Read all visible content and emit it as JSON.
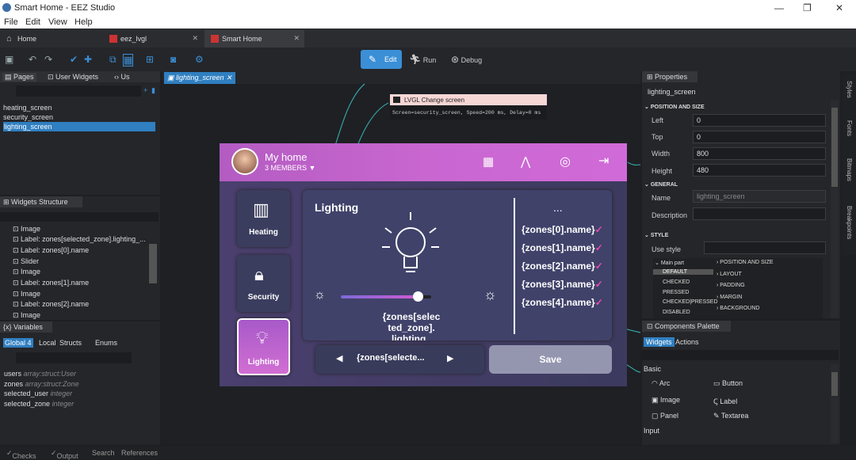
{
  "window": {
    "title": "Smart Home - EEZ Studio",
    "minimize": "—",
    "maximize": "❐",
    "close": "✕"
  },
  "menu": [
    "File",
    "Edit",
    "View",
    "Help"
  ],
  "tabs": [
    {
      "label": "Home"
    },
    {
      "label": "eez_lvgl"
    },
    {
      "label": "Smart Home"
    }
  ],
  "toolbar": {
    "edit": "Edit",
    "run": "Run",
    "debug": "Debug"
  },
  "left": {
    "tabs": [
      "Pages",
      "User Widgets",
      "Us"
    ],
    "pages": [
      "heating_screen",
      "security_screen",
      "lighting_screen"
    ],
    "widgets_title": "Widgets Structure",
    "widgets": [
      "Image",
      "Label: zones[selected_zone].lighting_...",
      "Label: zones[0].name",
      "Slider",
      "Image",
      "Label: zones[1].name",
      "Image",
      "Label: zones[2].name",
      "Image"
    ],
    "variables_title": "Variables",
    "var_tabs": [
      "Global",
      "Local",
      "Structs",
      "Enums"
    ],
    "global_count": "4",
    "vars": [
      {
        "name": "users",
        "type": "array:struct:User"
      },
      {
        "name": "zones",
        "type": "array:struct:Zone"
      },
      {
        "name": "selected_user",
        "type": "integer"
      },
      {
        "name": "selected_zone",
        "type": "integer"
      }
    ]
  },
  "editor_tab": "lighting_screen",
  "flow": {
    "node_title": "LVGL Change screen",
    "node_desc": "Screen=security_screen, Speed=200 ms, Delay=0 ms"
  },
  "lv": {
    "title": "My home",
    "members": "3 MEMBERS",
    "heating": "Heating",
    "security": "Security",
    "lighting": "Lighting",
    "lighting_title": "Lighting",
    "zones": [
      "{zones[0].name}",
      "{zones[1].name}",
      "{zones[2].name}",
      "{zones[3].name}",
      "{zones[4].name}"
    ],
    "ellipsis": "...",
    "center_text": "{zones[selec ted_zone]. lighting_ Percent + \" %\"}",
    "selector": "{zones[selecte...",
    "save": "Save",
    "slider_value": 0.85
  },
  "props": {
    "title": "Properties",
    "object": "lighting_screen",
    "pos_section": "POSITION AND SIZE",
    "left": "0",
    "top": "0",
    "width": "800",
    "height": "480",
    "general": "GENERAL",
    "name": "lighting_screen",
    "style": "STYLE",
    "labels": {
      "left": "Left",
      "top": "Top",
      "width": "Width",
      "height": "Height",
      "name": "Name",
      "description": "Description",
      "use_style": "Use style"
    },
    "states": [
      "Main part",
      "DEFAULT",
      "CHECKED",
      "PRESSED",
      "CHECKED|PRESSED",
      "DISABLED"
    ],
    "style_groups": [
      "POSITION AND SIZE",
      "LAYOUT",
      "PADDING",
      "MARGIN",
      "BACKGROUND"
    ]
  },
  "palette": {
    "title": "Components Palette",
    "tabs": [
      "Widgets",
      "Actions"
    ],
    "basic": "Basic",
    "items": [
      "Arc",
      "Button",
      "Image",
      "Label",
      "Panel",
      "Textarea"
    ],
    "input": "Input"
  },
  "side_tabs": [
    "Styles",
    "Fonts",
    "Bitmaps",
    "Breakpoints"
  ],
  "status": [
    "Checks",
    "Output",
    "Search",
    "References"
  ]
}
